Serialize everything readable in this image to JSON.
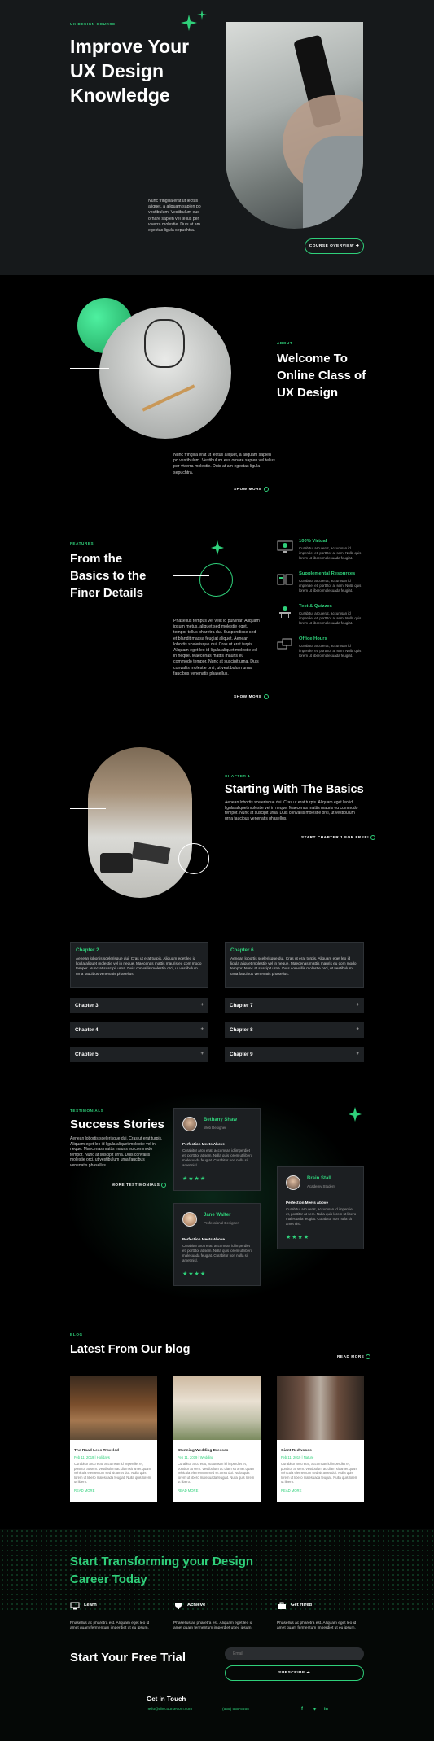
{
  "colors": {
    "accent": "#2fd07a",
    "bg": "#000000",
    "panel": "#16191b"
  },
  "hero": {
    "tag": "UX DESIGN COURSE",
    "title_lines": [
      "Improve Your",
      "UX Design",
      "Knowledge"
    ],
    "body": "Nunc fringilla erat ut lectus aliquet, a aliquam sapien po vestibulum. Vestibulum eus ornare sapien vel tellus per viverra molestie. Duis at am egestas ligula sepuchtra.",
    "button": "COURSE OVERVIEW"
  },
  "about": {
    "tag": "ABOUT",
    "title_lines": [
      "Welcome To",
      "Online Class of",
      "UX Design"
    ],
    "body": "Nunc fringilla erat ut lectus aliquet, a aliquam sapien po vestibulum. Vestibulum eus ornare sapien vel tellus per viverra molestie. Duis at am egestas ligula sepuchtra.",
    "link": "SHOW MORE"
  },
  "features": {
    "tag": "FEATURES",
    "title_lines": [
      "From the",
      "Basics to the",
      "Finer Details"
    ],
    "body": "Phasellus tempus vel velit id pulvinar. Aliquam ipsum metus, aliquet sed molestie eget, tempor tellus pharetra dui. Suspendisse sed et blandit massa feugiat aliquet. Aenean lobortis scelerisque dui. Cras ut erat turpis. Aliquam eget leo id ligula aliquet molestie vel in neque. Maecenas mattis mauris eu commodo tempor. Nunc at suscipit urna. Duis convallis molestie orci, ut vestibulum urna faucibus venenatis phasellus.",
    "link": "SHOW MORE",
    "items": [
      {
        "title": "100% Virtual",
        "text": "Curabitur arcu erat, accumsan id imperdiet et, porttitor at sem. Nulla quis lorem ut libero malesuada feugiat.",
        "icon": "monitor-icon"
      },
      {
        "title": "Supplemental Resources",
        "text": "Curabitur arcu erat, accumsan id imperdiet et, porttitor at sem. Nulla quis lorem ut libero malesuada feugiat.",
        "icon": "book-icon"
      },
      {
        "title": "Test & Quizzes",
        "text": "Curabitur arcu erat, accumsan id imperdiet et, porttitor at sem. Nulla quis lorem ut libero malesuada feugiat.",
        "icon": "desk-icon"
      },
      {
        "title": "Office Hours",
        "text": "Curabitur arcu erat, accumsan id imperdiet et, porttitor at sem. Nulla quis lorem ut libero malesuada feugiat.",
        "icon": "screens-icon"
      }
    ]
  },
  "chapter1": {
    "tag": "CHAPTER 1",
    "title": "Starting With The Basics",
    "body": "Aenean lobortis scelerisque dui. Cras ut erat turpis. Aliquam eget leo id ligula aliquet molestie vel in neque. Maecenas mattis mauris eu commodo tempor. Nunc at suscipit urna. Duis convallis molestie orci, ut vestibulum urna faucibus venenatis phasellus.",
    "link": "START CHAPTER 1 FOR FREE!"
  },
  "chapters": {
    "open_left": {
      "title": "Chapter 2",
      "text": "Aenean lobortis scelerisque dui. Cras ut erat turpis. Aliquam eget leo id ligula aliquet molestie vel in neque. Maecenas mattis mauris eu com modo tempor. Nunc at suscipit urna. Duis convallis molestie orci, ut vestibulum urna faucibus venenatis phasellus."
    },
    "open_right": {
      "title": "Chapter 6",
      "text": "Aenean lobortis scelerisque dui. Cras ut erat turpis. Aliquam eget leo id ligula aliquet molestie vel in neque. Maecenas mattis mauris eu com modo tempor. Nunc at suscipit urna. Duis convallis molestie orci, ut vestibulum urna faucibus venenatis phasellus."
    },
    "left": [
      "Chapter 3",
      "Chapter 4",
      "Chapter 5"
    ],
    "right": [
      "Chapter 7",
      "Chapter 8",
      "Chapter 9"
    ]
  },
  "testimonials": {
    "tag": "TESTIMONIALS",
    "title": "Success Stories",
    "body": "Aenean lobortis scelerisque dui. Cras ut erat turpis. Aliquam eget leo id ligula aliquet molestie vel in neque. Maecenas mattis mauris eu commodo tempor. Nunc at suscipit urna. Duis convallis molestie orci, ut vestibulum urna faucibus venenatis phasellus.",
    "link": "MORE TESTIMONIALS",
    "people": [
      {
        "name": "Bethany Shaw",
        "role": "Web Designer",
        "heading": "Perfection Meets Above",
        "text": "Curabitur arcu erat, accumsan id imperdiet et, porttitor at sem. Nulla quis lorem ut libero malesuada feugiat. Curabitur non nulla sit amet nisl."
      },
      {
        "name": "Brain Stall",
        "role": "Academy Student",
        "heading": "Perfection Meets Above",
        "text": "Curabitur arcu erat, accumsan id imperdiet et, porttitor at sem. Nulla quis lorem ut libero malesuada feugiat. Curabitur non nulla sit amet nisl."
      },
      {
        "name": "Jane Walter",
        "role": "Professional Designer",
        "heading": "Perfection Meets Above",
        "text": "Curabitur arcu erat, accumsan id imperdiet et, porttitor at sem. Nulla quis lorem ut libero malesuada feugiat. Curabitur non nulla sit amet nisl."
      }
    ]
  },
  "blog": {
    "tag": "BLOG",
    "title": "Latest From Our blog",
    "link": "READ MORE",
    "posts": [
      {
        "title": "The Road Less Traveled",
        "date": "Feb 11, 2019 | Holidays",
        "text": "Curabitur arcu erat, accumsan id imperdiet et, porttitor at sem. Vestibulum ac diam sit amet quam vehicula elementum sed sit amet dui. Nulla quis lorem ut libero malesuada feugiat. Nulla quis lorem ut libero.",
        "more": "READ MORE"
      },
      {
        "title": "Stunning Wedding Dresses",
        "date": "Feb 11, 2019 | Wedding",
        "text": "Curabitur arcu erat, accumsan id imperdiet et, porttitor at sem. Vestibulum ac diam sit amet quam vehicula elementum sed sit amet dui. Nulla quis lorem ut libero malesuada feugiat. Nulla quis lorem ut libero.",
        "more": "READ MORE"
      },
      {
        "title": "Giant Redwoods",
        "date": "Feb 11, 2019 | Nature",
        "text": "Curabitur arcu erat, accumsan id imperdiet et, porttitor at sem. Vestibulum ac diam sit amet quam vehicula elementum sed sit amet dui. Nulla quis lorem ut libero malesuada feugiat. Nulla quis lorem ut libero.",
        "more": "READ MORE"
      }
    ]
  },
  "cta": {
    "title_lines": [
      "Start Transforming your Design",
      "Career Today"
    ],
    "items": [
      {
        "label": "Learn",
        "icon": "monitor-icon",
        "text": "Phasellus ac pharetra est. Aliquam eget leo id amet quam fermentum imperdiet ut eu ipsum."
      },
      {
        "label": "Achieve",
        "icon": "trophy-icon",
        "text": "Phasellus ac pharetra est. Aliquam eget leo id amet quam fermentum imperdiet ut eu ipsum."
      },
      {
        "label": "Get Hired",
        "icon": "briefcase-icon",
        "text": "Phasellus ac pharetra est. Aliquam eget leo id amet quam fermentum imperdiet ut eu ipsum."
      }
    ],
    "trial_title": "Start Your Free Trial",
    "email_placeholder": "Email",
    "subscribe": "SUBSCRIBE"
  },
  "footer": {
    "title": "Get in Touch",
    "email": "hello@divicoursecom.com",
    "phone": "(555) 555-5555"
  }
}
